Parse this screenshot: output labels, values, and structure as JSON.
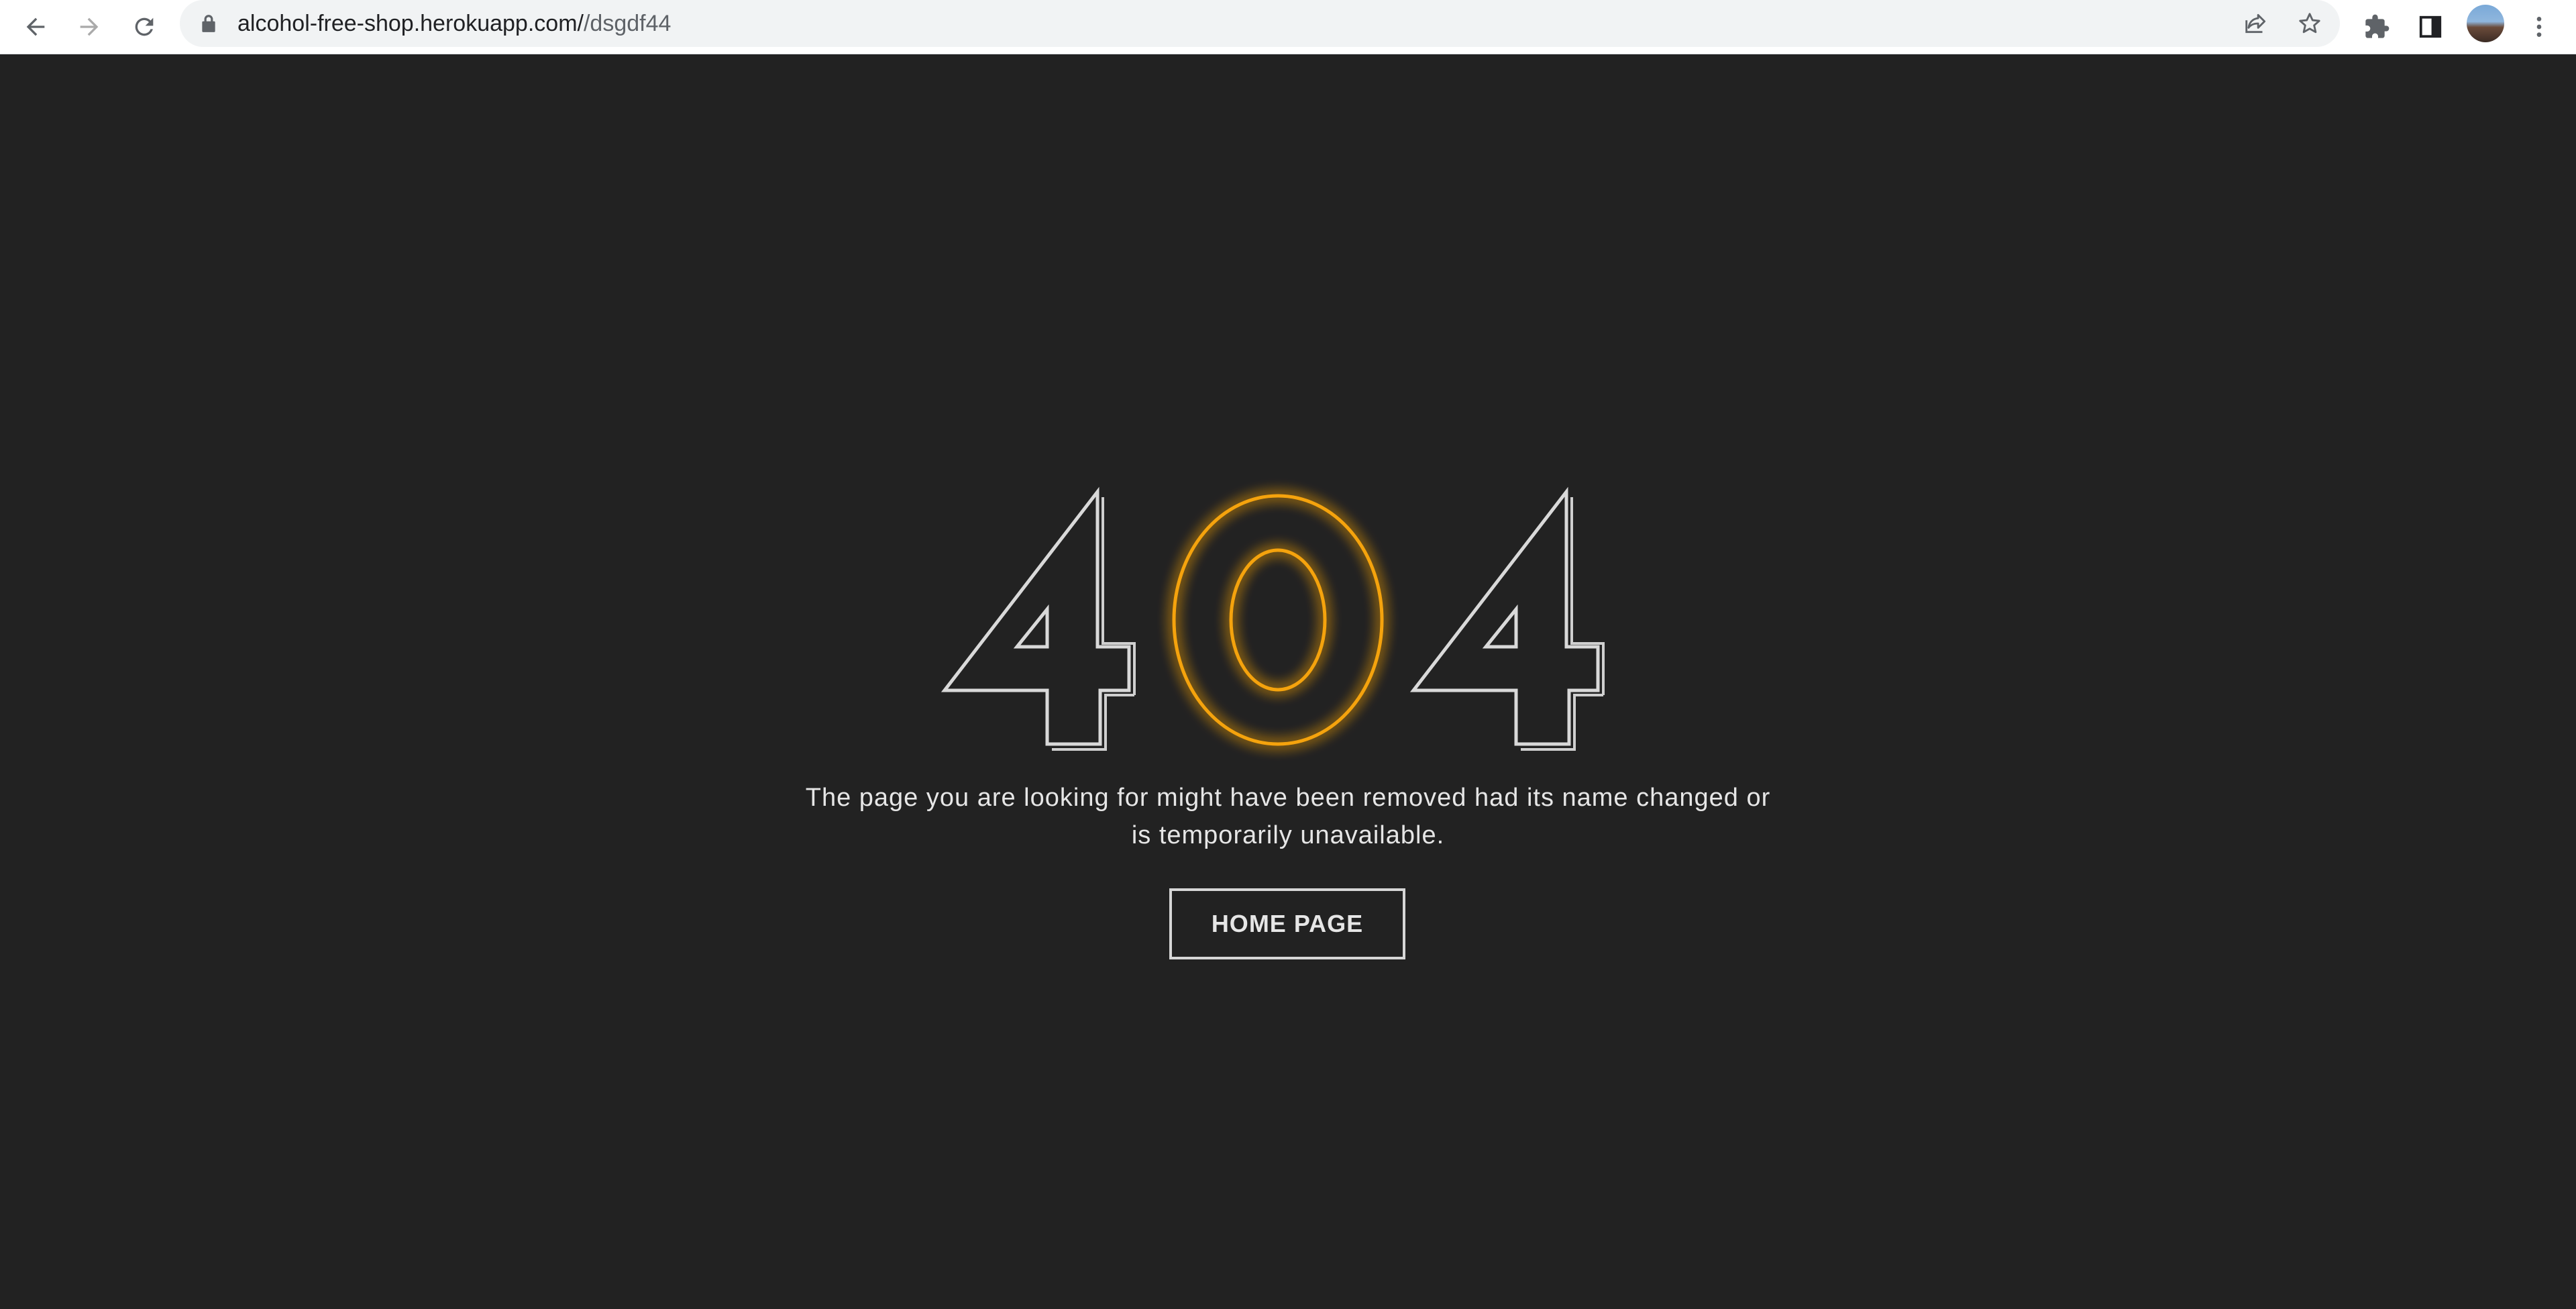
{
  "browser": {
    "url_host": "alcohol-free-shop.herokuapp.com/",
    "url_path": "/dsgdf44",
    "icons": {
      "back": "back-arrow-icon",
      "forward": "forward-arrow-icon",
      "reload": "reload-icon",
      "lock": "lock-icon",
      "share": "share-icon",
      "bookmark": "star-icon",
      "extensions": "puzzle-icon",
      "side_panel": "side-panel-icon",
      "menu": "kebab-menu-icon"
    }
  },
  "page": {
    "code_digit_1": "4",
    "code_digit_2": "0",
    "code_digit_3": "4",
    "message": "The page you are looking for might have been removed had its name changed or is temporarily unavailable.",
    "home_button_label": "HOME PAGE"
  },
  "colors": {
    "background": "#222222",
    "outline": "#d9d9d9",
    "glow": "#f5a30a"
  }
}
